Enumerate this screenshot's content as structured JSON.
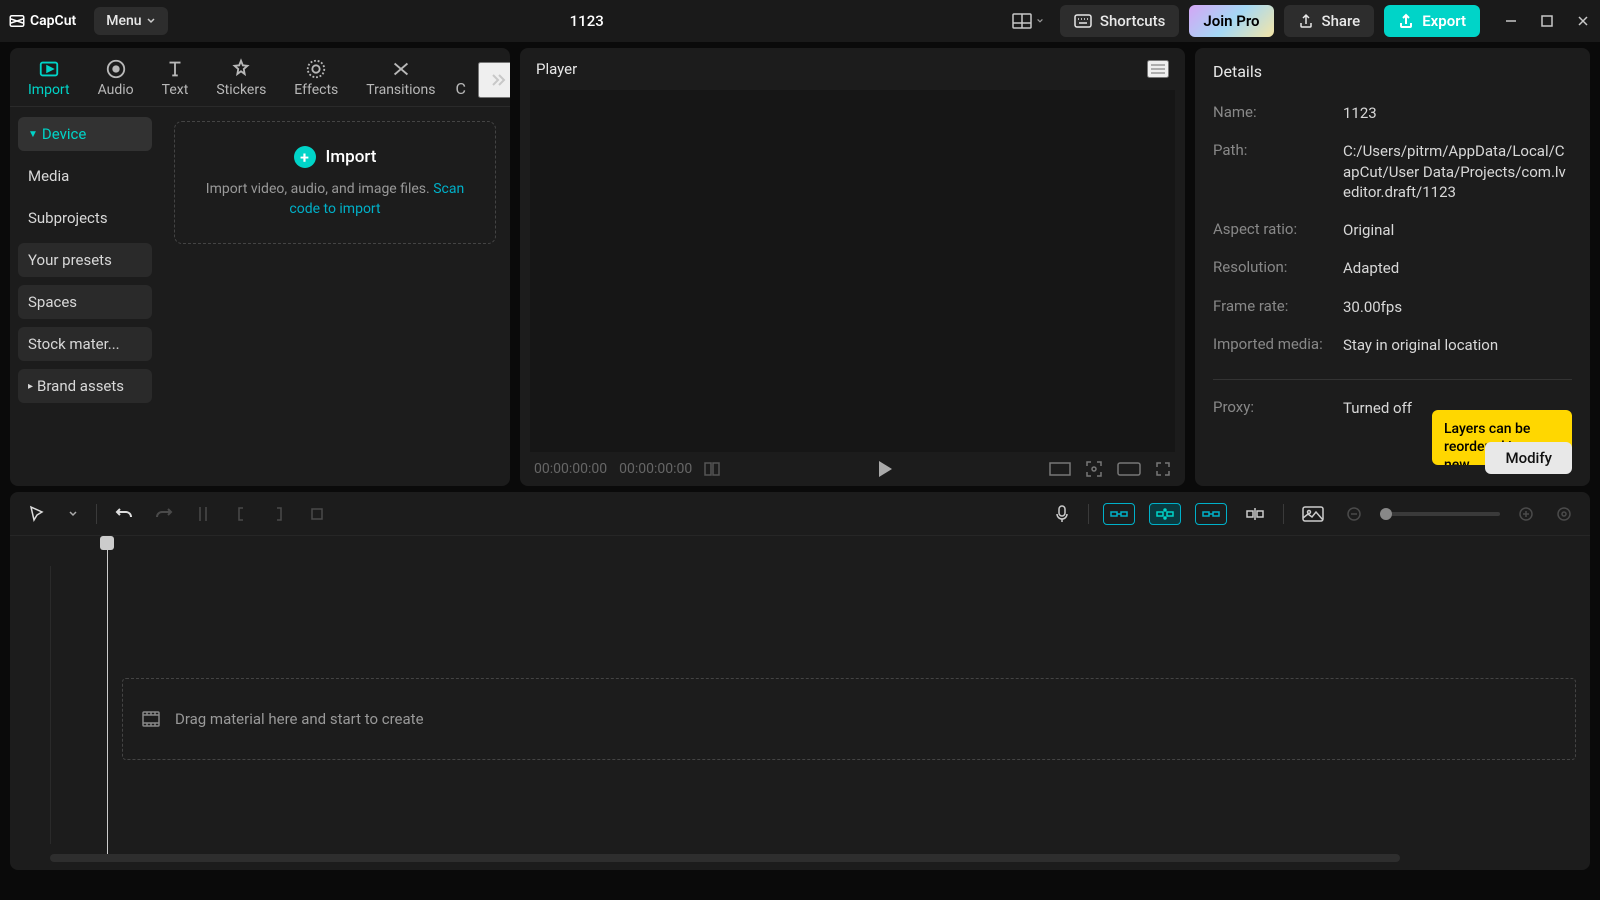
{
  "app": {
    "name": "CapCut",
    "menu": "Menu",
    "title": "1123"
  },
  "titlebar": {
    "shortcuts": "Shortcuts",
    "join_pro": "Join Pro",
    "share": "Share",
    "export": "Export"
  },
  "media_tabs": {
    "import": "Import",
    "audio": "Audio",
    "text": "Text",
    "stickers": "Stickers",
    "effects": "Effects",
    "transitions": "Transitions",
    "more_initial": "C"
  },
  "sidebar": {
    "device": "Device",
    "media": "Media",
    "subprojects": "Subprojects",
    "your_presets": "Your presets",
    "spaces": "Spaces",
    "stock": "Stock mater...",
    "brand": "Brand assets"
  },
  "import_box": {
    "title": "Import",
    "desc_prefix": "Import video, audio, and image files. ",
    "link": "Scan code to import"
  },
  "player": {
    "title": "Player",
    "time_current": "00:00:00:00",
    "time_total": "00:00:00:00"
  },
  "details": {
    "title": "Details",
    "name_label": "Name:",
    "name_value": "1123",
    "path_label": "Path:",
    "path_value": "C:/Users/pitrm/AppData/Local/CapCut/User Data/Projects/com.lveditor.draft/1123",
    "aspect_label": "Aspect ratio:",
    "aspect_value": "Original",
    "res_label": "Resolution:",
    "res_value": "Adapted",
    "fps_label": "Frame rate:",
    "fps_value": "30.00fps",
    "imported_label": "Imported media:",
    "imported_value": "Stay in original location",
    "proxy_label": "Proxy:",
    "proxy_value": "Turned off",
    "modify": "Modify",
    "tooltip": "Layers can be reordered in every new"
  },
  "timeline": {
    "drop_hint": "Drag material here and start to create"
  }
}
